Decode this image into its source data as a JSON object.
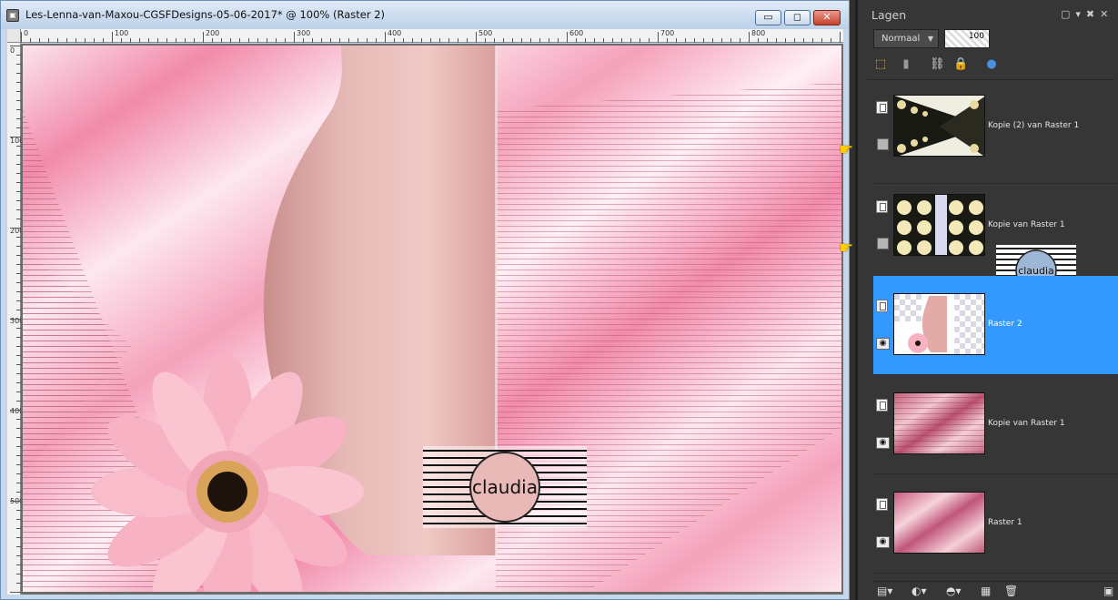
{
  "document": {
    "title": "Les-Lenna-van-Maxou-CGSFDesigns-05-06-2017* @ 100% (Raster 2)",
    "ruler_labels": [
      "0",
      "100",
      "200",
      "300",
      "400",
      "500",
      "600",
      "700",
      "800"
    ],
    "ruler_left_labels": [
      "0",
      "100",
      "200",
      "300",
      "400",
      "500"
    ],
    "watermark_text": "claudia"
  },
  "window_buttons": {
    "minimize": "▭",
    "maximize": "◻",
    "close": "✕"
  },
  "layers_panel": {
    "title": "Lagen",
    "blend_mode": "Normaal",
    "opacity": "100",
    "layers": [
      {
        "name": "Kopie (2) van Raster 1",
        "visible": false,
        "active": false
      },
      {
        "name": "Kopie van Raster 1",
        "visible": false,
        "active": false
      },
      {
        "name": "Raster 2",
        "visible": true,
        "active": true
      },
      {
        "name": "Kopie van Raster 1",
        "visible": true,
        "active": false
      },
      {
        "name": "Raster 1",
        "visible": true,
        "active": false
      }
    ]
  },
  "icons": {
    "pointer": "pointing-hand-icon",
    "eye": "eye-icon",
    "doc": "layer-doc-icon"
  },
  "colors": {
    "accent_blue": "#3399ff",
    "pink": "#f08aa8",
    "vase": "#dda6a3",
    "panel_bg": "#363636"
  }
}
